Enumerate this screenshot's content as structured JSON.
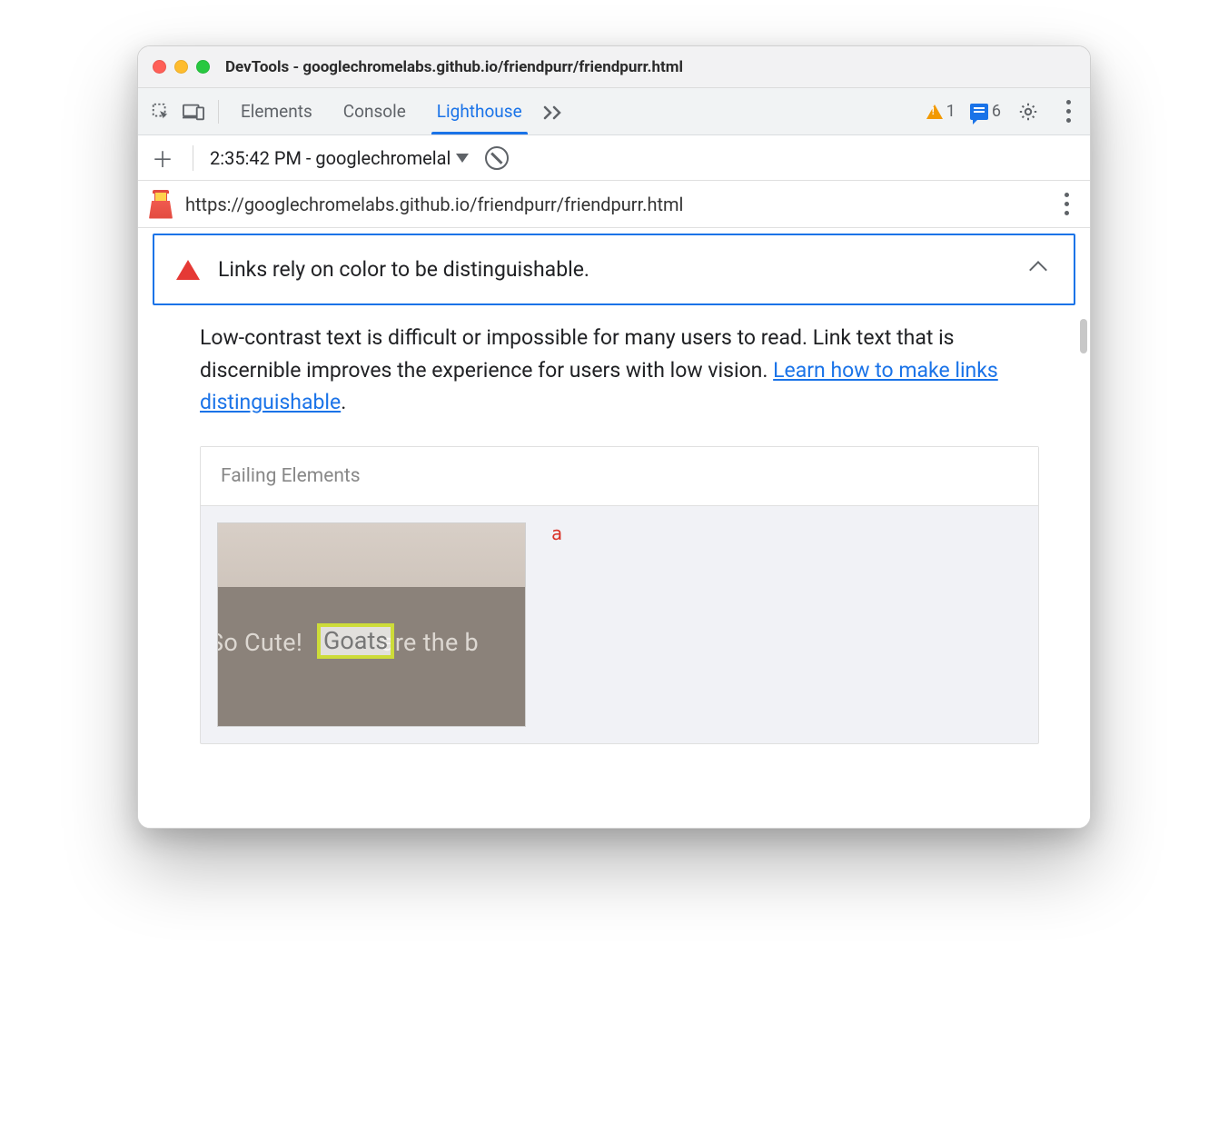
{
  "window": {
    "title": "DevTools - googlechromelabs.github.io/friendpurr/friendpurr.html"
  },
  "toolbar": {
    "tabs": {
      "elements": "Elements",
      "console": "Console",
      "lighthouse": "Lighthouse"
    },
    "warnings_count": "1",
    "messages_count": "6"
  },
  "reportbar": {
    "label": "2:35:42 PM - googlechromelal"
  },
  "urlbar": {
    "url": "https://googlechromelabs.github.io/friendpurr/friendpurr.html"
  },
  "audit": {
    "title": "Links rely on color to be distinguishable.",
    "description_pre": "Low-contrast text is difficult or impossible for many users to read. Link text that is discernible improves the experience for users with low vision. ",
    "learn_link": "Learn how to make links distinguishable",
    "failing_title": "Failing Elements",
    "element_tag": "a",
    "thumb_text_left": "So Cute! ",
    "thumb_text_hl": "Goats",
    "thumb_text_right": " are the b"
  }
}
